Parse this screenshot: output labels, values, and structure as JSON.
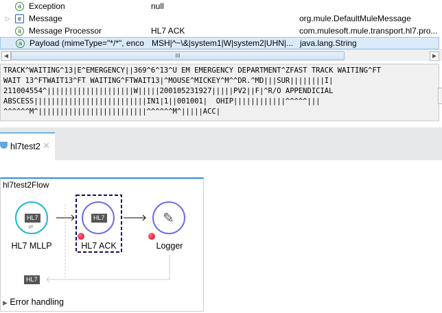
{
  "variables": [
    {
      "icon": "a",
      "name": "Exception",
      "value": "null",
      "type": ""
    },
    {
      "icon": "e",
      "name": "Message",
      "value": "",
      "type": "org.mule.DefaultMuleMessage",
      "expandable": true
    },
    {
      "icon": "a",
      "name": "Message Processor",
      "value": "HL7 ACK",
      "type": "com.mulesoft.mule.transport.hl7.pro..."
    },
    {
      "icon": "a",
      "name": "Payload (mimeType=\"*/*\", enco",
      "value": "MSH|^~\\&|system1|W|system2|UHN|...",
      "type": "java.lang.String"
    }
  ],
  "scroll_grip": "III",
  "payload_text": "TRACK^WAITING^13|E^EMERGENCY||369^6^13^U EM EMERGENCY DEPARTMENT^ZFAST TRACK WAITING^FT\nWAIT 13^FTWAIT13^FT WAITING^FTWAIT13|^MOUSE^MICKEY^M^^DR.^MD|||SUR||||||||I|\n211004554^||||||||||||||||||||W|||||200105231927|||||PV2||F|^R/O APPENDICIAL\nABSCESS||||||||||||||||||||||||||IN1|1||001001|  OHIP||||||||||||^^^^^|||\n^^^^^^M^|||||||||||||||||||||||||^^^^^^M^|||||ACC|",
  "editor_tab": "hl7test2",
  "flow": {
    "name": "hl7test2Flow",
    "nodes": [
      {
        "label": "HL7 MLLP",
        "badge": "HL7"
      },
      {
        "label": "HL7 ACK",
        "badge": "HL7"
      },
      {
        "label": "Logger"
      }
    ],
    "response_badge": "HL7",
    "error_handling": "Error handling"
  },
  "colors": {
    "selection": "#dbeaf9",
    "flow_border": "#2a8fd9",
    "endpoint": "#1fb8d0",
    "processor": "#6a6cf0",
    "breakpoint": "#e0002a"
  }
}
